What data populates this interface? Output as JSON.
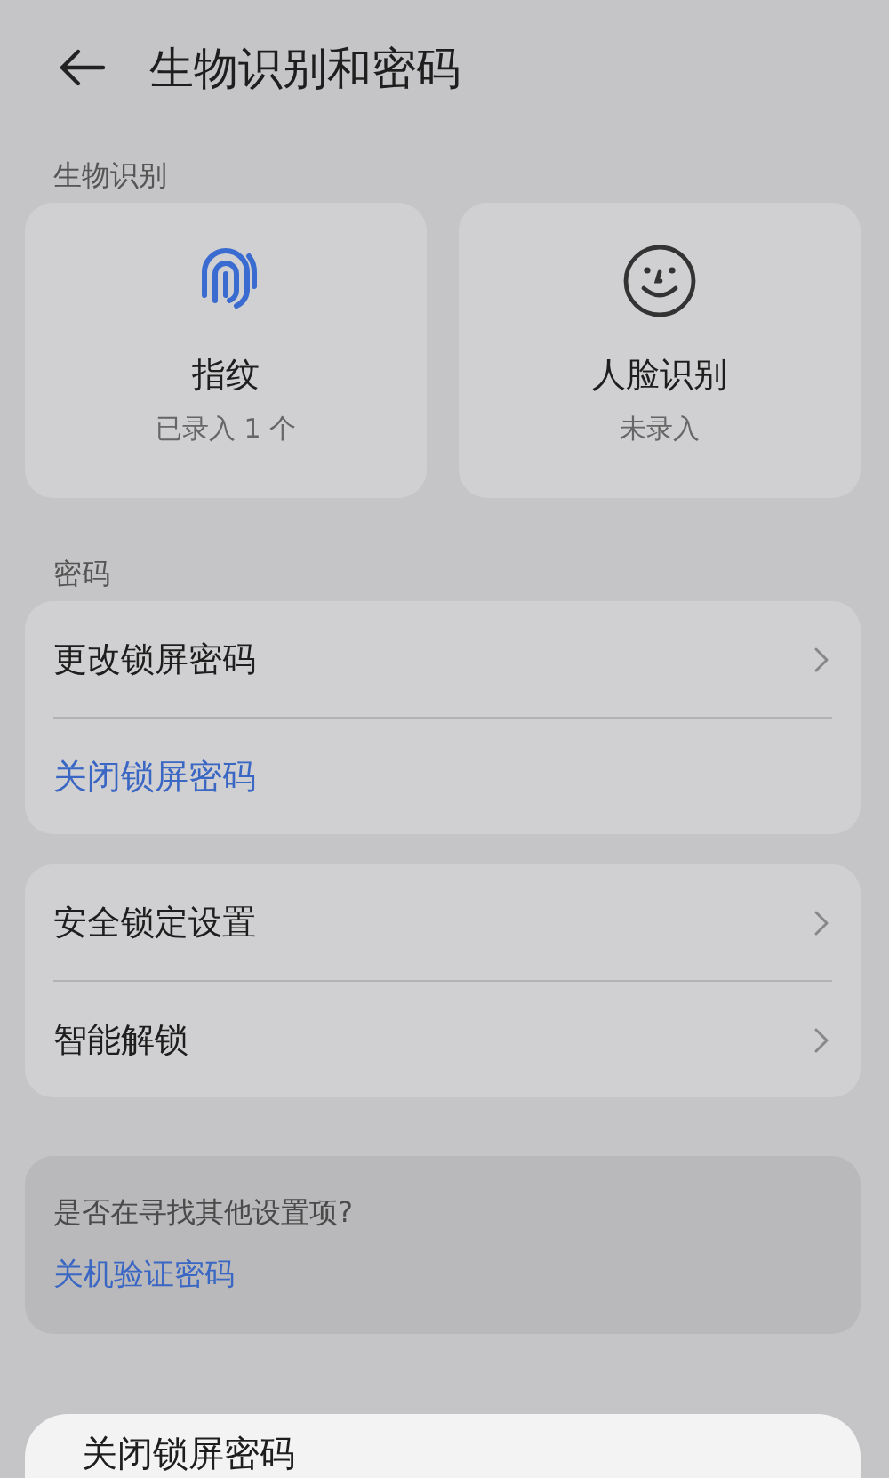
{
  "header": {
    "title": "生物识别和密码"
  },
  "biometrics": {
    "label": "生物识别",
    "items": [
      {
        "kind": "fingerprint",
        "name": "指纹",
        "status": "已录入 1 个"
      },
      {
        "kind": "face",
        "name": "人脸识别",
        "status": "未录入"
      }
    ]
  },
  "password": {
    "label": "密码",
    "groups": [
      [
        {
          "kind": "nav",
          "label": "更改锁屏密码"
        },
        {
          "kind": "action",
          "label": "关闭锁屏密码"
        }
      ],
      [
        {
          "kind": "nav",
          "label": "安全锁定设置"
        },
        {
          "kind": "nav",
          "label": "智能解锁"
        }
      ]
    ]
  },
  "suggestion": {
    "question": "是否在寻找其他设置项?",
    "link": "关机验证密码"
  },
  "sheet": {
    "title": "关闭锁屏密码"
  }
}
